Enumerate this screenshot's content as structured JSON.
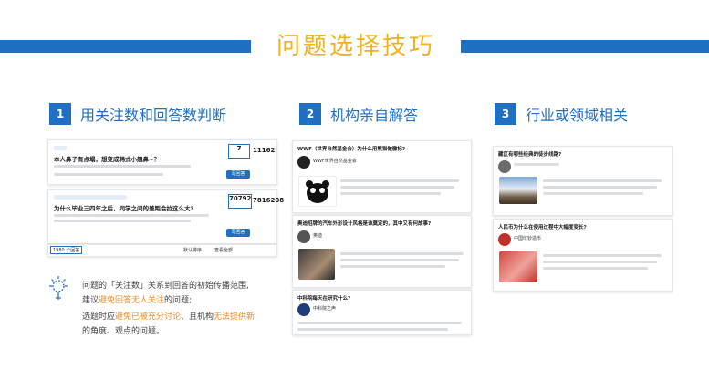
{
  "header": {
    "title": "问题选择技巧"
  },
  "sections": [
    {
      "num": "1",
      "title": "用关注数和回答数判断"
    },
    {
      "num": "2",
      "title": "机构亲自解答"
    },
    {
      "num": "3",
      "title": "行业或领域相关"
    }
  ],
  "panel1": {
    "card1": {
      "question": "本人鼻子有点塌，想变成韩式小翘鼻~？",
      "follow_count": "7",
      "view_count": "11162",
      "button": "写回答"
    },
    "card2": {
      "question": "为什么毕业三四年之后，同学之间的差距会拉这么大?",
      "follow_count": "70792",
      "view_count": "7816208",
      "button": "写回答"
    },
    "footer": {
      "answers": "1980 个回答",
      "sort": "默认排序",
      "view_all": "查看全部"
    }
  },
  "panel2": {
    "card1": {
      "question": "WWF（世界自然基金会）为什么用熊猫做徽标?",
      "org": "WWF世界自然基金会"
    },
    "card2": {
      "question": "奥迪招牌的汽车外形设计风格是谁奠定的，其中又有何故事?",
      "org": "奥迪"
    },
    "card3": {
      "question": "中科院每天在研究什么?",
      "org": "中科院之声"
    }
  },
  "panel3": {
    "card1": {
      "question": "藏区有哪些经典的徒步线路?"
    },
    "card2": {
      "question": "人民币为什么在使用过程中大幅度变长?",
      "org": "中国印钞造币"
    }
  },
  "tips": {
    "line1": "问题的「关注数」关系到回答的初始传播范围,",
    "line2_pre": "建议",
    "line2_hl": "避免回答无人关注",
    "line2_post": "的问题;",
    "line3_pre": "选题时应",
    "line3_hl1": "避免已被充分讨论",
    "line3_mid": "、且机构",
    "line3_hl2": "无法提供新",
    "line4": "的角度、观点的问题。"
  },
  "colors": {
    "accent_blue": "#1f6fc2",
    "title_yellow": "#f3b21a",
    "highlight_orange": "#f08a24"
  }
}
